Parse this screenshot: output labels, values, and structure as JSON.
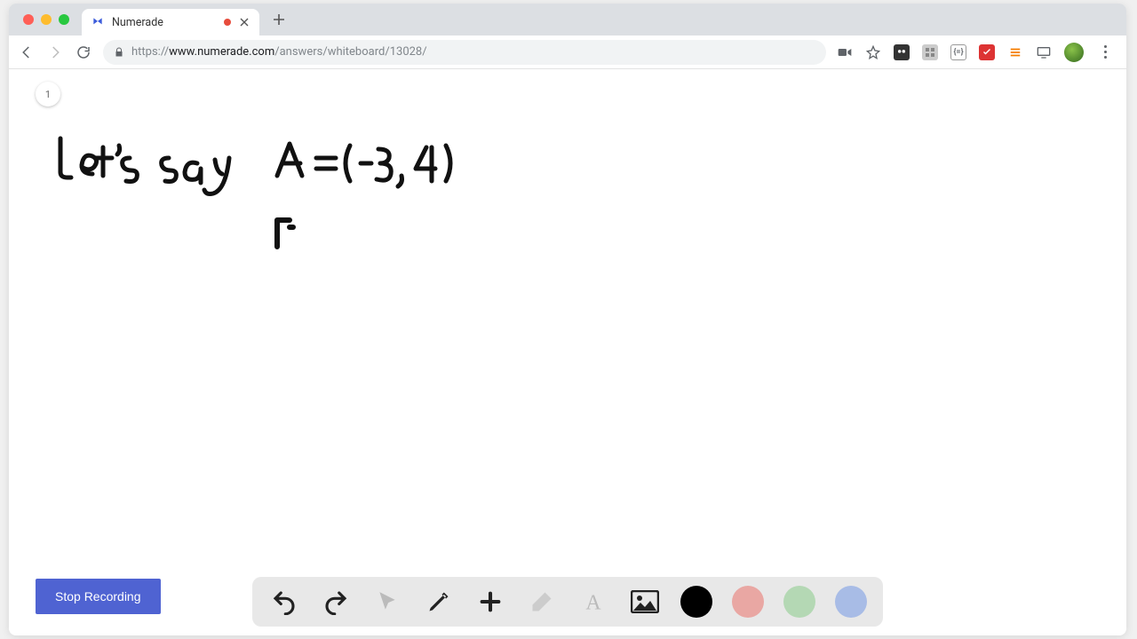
{
  "browser": {
    "tab_title": "Numerade",
    "url_scheme": "https://",
    "url_host": "www.numerade.com",
    "url_path": "/answers/whiteboard/13028/"
  },
  "page": {
    "page_number": "1",
    "handwriting_lines": [
      "Let's say   A = (-3, 4)",
      "            B"
    ],
    "stop_button_label": "Stop Recording"
  },
  "tools": {
    "undo": "undo-icon",
    "redo": "redo-icon",
    "pointer": "pointer-icon",
    "pencil": "pencil-icon",
    "plus": "plus-icon",
    "eraser": "eraser-icon",
    "text": "text-icon",
    "image": "image-icon",
    "colors": {
      "black": "#000000",
      "red": "#e9a7a3",
      "green": "#b4d8b4",
      "blue": "#a8bce6"
    }
  },
  "icons": {
    "close": "×",
    "plus": "+",
    "back": "←",
    "forward": "→",
    "reload": "⟳",
    "camera": "video-icon",
    "star": "star-icon",
    "ext_mask": "mask-icon",
    "ext_grid": "grid-icon",
    "ext_eq": "{=}",
    "ext_red": "✓",
    "ext_orange": "≡",
    "ext_screen": "screen-icon"
  }
}
